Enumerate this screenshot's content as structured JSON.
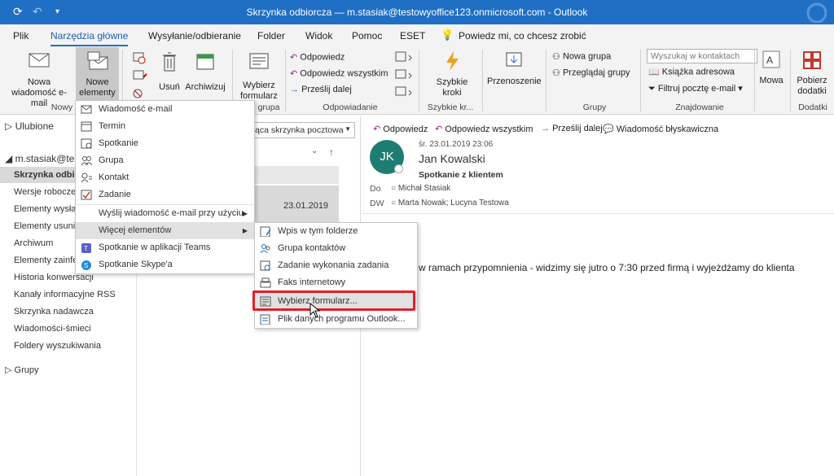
{
  "window": {
    "title": "Skrzynka odbiorcza — m.stasiak@testowyoffice123.onmicrosoft.com  -  Outlook"
  },
  "tabs": [
    "Plik",
    "Narzędzia główne",
    "Wysyłanie/odbieranie",
    "Folder",
    "Widok",
    "Pomoc",
    "ESET"
  ],
  "tellme": "Powiedz mi, co chcesz zrobić",
  "ribbon": {
    "new_email": "Nowa wiadomość e-mail",
    "new_items": "Nowe elementy",
    "delete": "Usuń",
    "archive": "Archiwizuj",
    "choose_form": "Wybierz formularz",
    "reply": "Odpowiedz",
    "reply_all": "Odpowiedz wszystkim",
    "forward": "Prześlij dalej",
    "quick_steps": "Szybkie kroki",
    "move": "Przenoszenie",
    "new_group": "Nowa grupa",
    "browse_groups": "Przeglądaj grupy",
    "search_placeholder": "Wyszukaj w kontaktach",
    "address_book": "Książka adresowa",
    "filter_email": "Filtruj pocztę e-mail",
    "speech": "Mowa",
    "addins": "Pobierz dodatki",
    "groups": {
      "new": "Nowy",
      "group": "grupa",
      "respond": "Odpowiadanie",
      "quick": "Szybkie kr...",
      "groups": "Grupy",
      "find": "Znajdowanie",
      "addins": "Dodatki"
    }
  },
  "folders": {
    "favorites": "Ulubione",
    "account": "m.stasiak@te",
    "items": [
      "Skrzynka odbio",
      "Wersje robocze [",
      "Elementy wysłan",
      "Elementy usunię",
      "Archiwum",
      "Elementy zainfek",
      "Historia konwersacji",
      "Kanały informacyjne RSS",
      "Skrzynka nadawcza",
      "Wiadomości-śmieci",
      "Foldery wyszukiwania"
    ],
    "groups": "Grupy"
  },
  "list": {
    "scope": "ąca skrzynka pocztowa",
    "date": "23.01.2019"
  },
  "reading": {
    "actions": [
      "Odpowiedz",
      "Odpowiedz wszystkim",
      "Prześlij dalej",
      "Wiadomość błyskawiczna"
    ],
    "initials": "JK",
    "datetime": "śr. 23.01.2019 23:06",
    "sender": "Jan Kowalski",
    "subject": "Spotkanie z klientem",
    "to_label": "Do",
    "to": "Michał Stasiak",
    "cc_label": "DW",
    "cc": "Marta Nowak; Lucyna Testowa",
    "body": "w ramach przypomnienia - widzimy się jutro o 7:30 przed firmą i wyjeżdżamy do klienta"
  },
  "menu1": [
    "Wiadomość e-mail",
    "Termin",
    "Spotkanie",
    "Grupa",
    "Kontakt",
    "Zadanie",
    "Wyślij wiadomość e-mail przy użyciu",
    "Więcej elementów",
    "Spotkanie w aplikacji Teams",
    "Spotkanie Skype'a"
  ],
  "menu2": [
    "Wpis w tym folderze",
    "Grupa kontaktów",
    "Zadanie wykonania zadania",
    "Faks internetowy",
    "Wybierz formularz...",
    "Plik danych programu Outlook..."
  ],
  "colors": {
    "accent": "#1f6fc5",
    "avatar": "#1e7d73",
    "highlight": "#e0202a"
  }
}
